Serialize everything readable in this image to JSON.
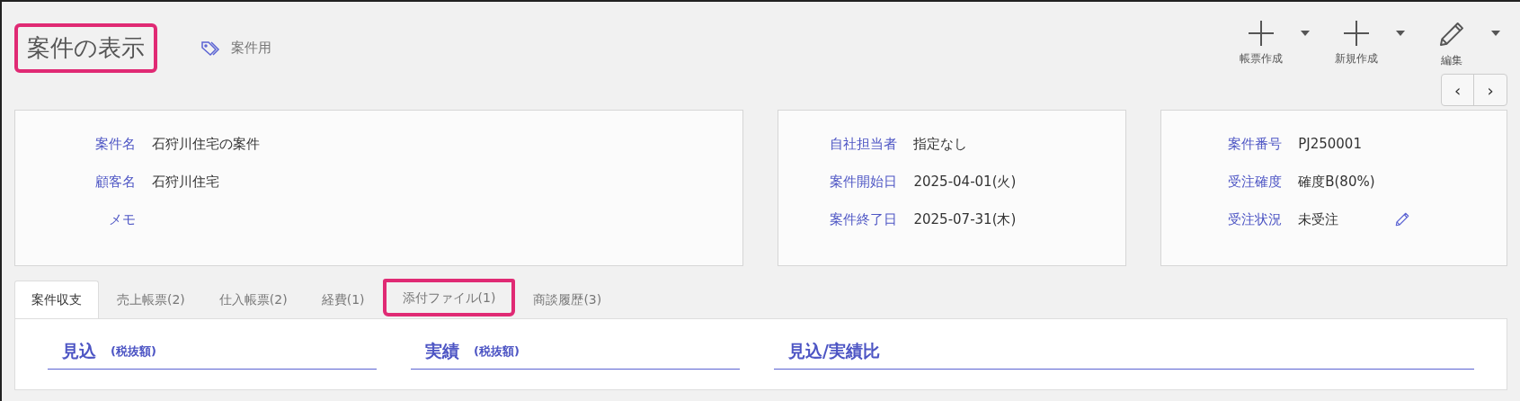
{
  "header": {
    "title": "案件の表示",
    "title_highlighted": true,
    "tag": "案件用"
  },
  "toolbar": [
    {
      "kind": "plus",
      "label": "帳票作成"
    },
    {
      "kind": "plus",
      "label": "新規作成"
    },
    {
      "kind": "pencil",
      "label": "編集"
    }
  ],
  "pager": {
    "prev": "‹",
    "next": "›"
  },
  "cards": [
    {
      "fields": [
        {
          "label": "案件名",
          "value": "石狩川住宅の案件"
        },
        {
          "label": "顧客名",
          "value": "石狩川住宅"
        },
        {
          "label": "メモ"
        }
      ]
    },
    {
      "fields": [
        {
          "label": "自社担当者",
          "value": "指定なし"
        },
        {
          "label": "案件開始日",
          "value": "2025-04-01(火)"
        },
        {
          "label": "案件終了日",
          "value": "2025-07-31(木)"
        }
      ]
    },
    {
      "fields": [
        {
          "label": "案件番号",
          "value": "PJ250001"
        },
        {
          "label": "受注確度",
          "value": "確度B(80%)"
        },
        {
          "label": "受注状況",
          "value": "未受注",
          "editable": true
        }
      ]
    }
  ],
  "tabs": [
    {
      "label": "案件収支",
      "selected": true,
      "highlighted": false
    },
    {
      "label": "売上帳票(2)",
      "selected": false,
      "highlighted": false
    },
    {
      "label": "仕入帳票(2)",
      "selected": false,
      "highlighted": false
    },
    {
      "label": "経費(1)",
      "selected": false,
      "highlighted": false
    },
    {
      "label": "添付ファイル(1)",
      "selected": false,
      "highlighted": true
    },
    {
      "label": "商談履歴(3)",
      "selected": false,
      "highlighted": false
    }
  ],
  "sections": [
    {
      "title": "見込",
      "note": "(税抜額)"
    },
    {
      "title": "実績",
      "note": "(税抜額)"
    },
    {
      "title": "見込/実績比"
    }
  ]
}
